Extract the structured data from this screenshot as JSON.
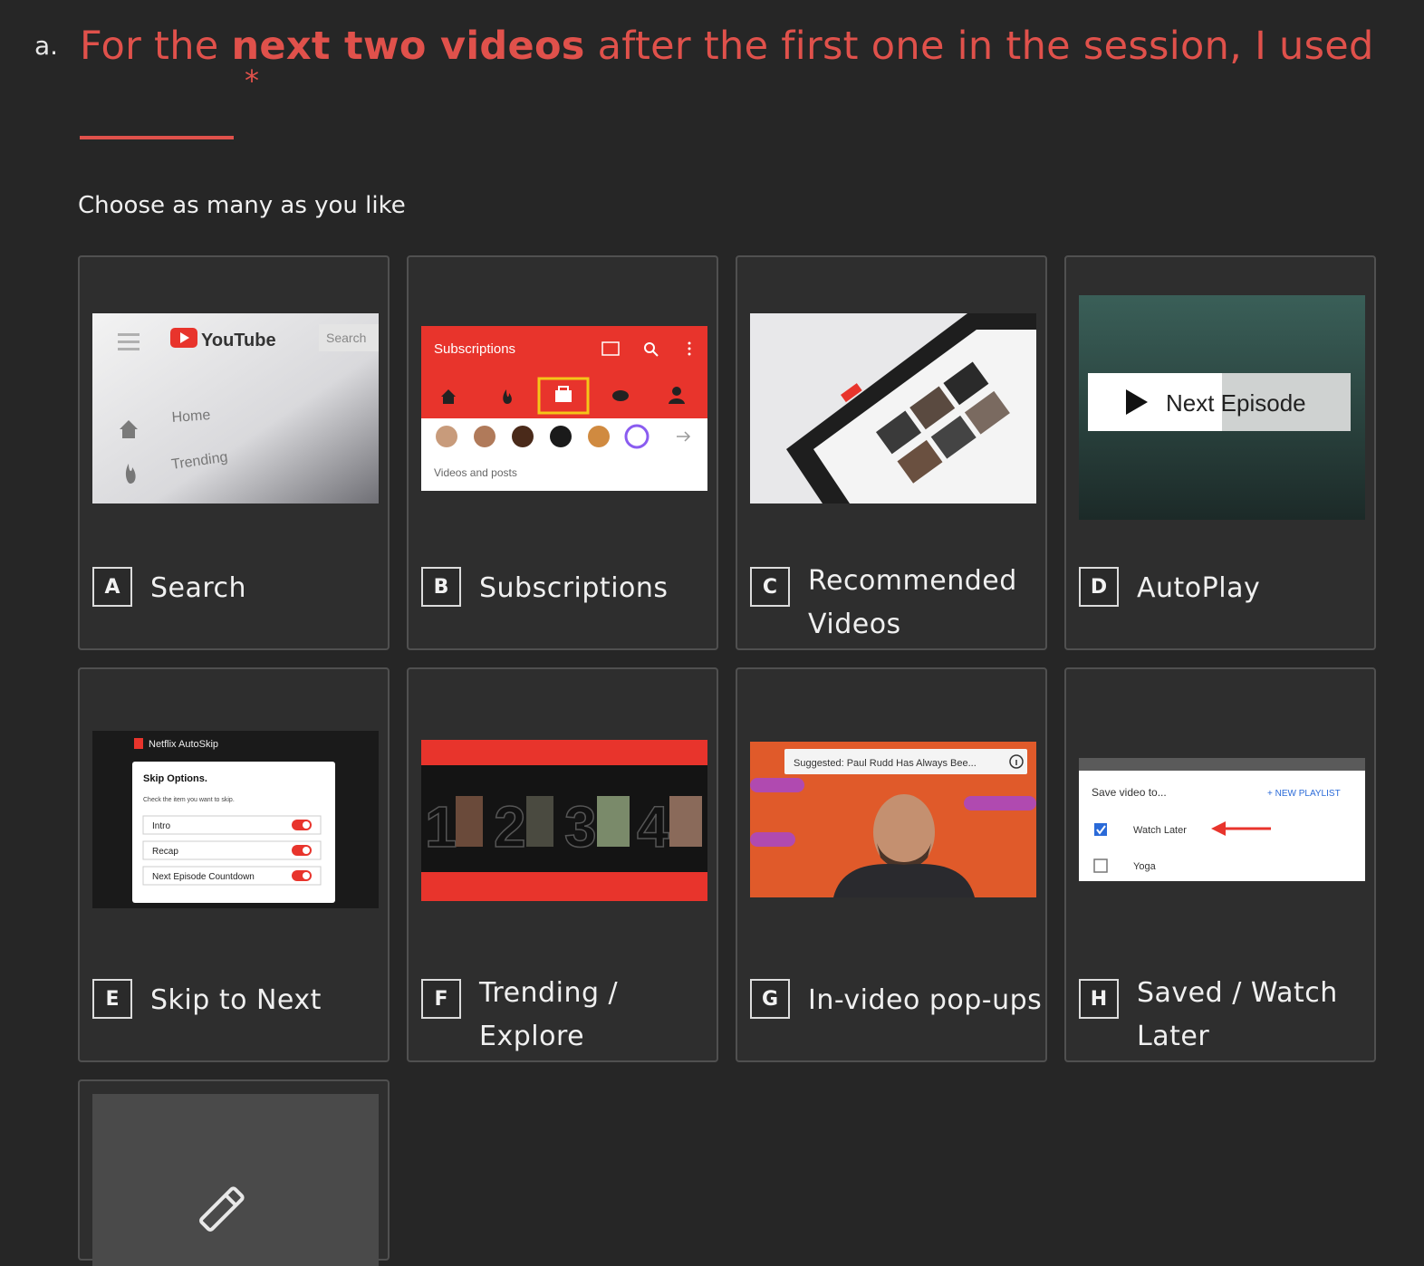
{
  "question": {
    "number": "a.",
    "text_before": "For the ",
    "text_bold": "next two videos",
    "text_after": " after the first one in the session, I used",
    "required_mark": "*"
  },
  "hint": "Choose as many as you like",
  "options": [
    {
      "key": "A",
      "label": "Search"
    },
    {
      "key": "B",
      "label": "Subscriptions"
    },
    {
      "key": "C",
      "label": "Recommended Videos"
    },
    {
      "key": "D",
      "label": "AutoPlay"
    },
    {
      "key": "E",
      "label": "Skip to Next"
    },
    {
      "key": "F",
      "label": "Trending / Explore"
    },
    {
      "key": "G",
      "label": "In-video pop-ups"
    },
    {
      "key": "H",
      "label": "Saved / Watch Later"
    }
  ],
  "thumb_text": {
    "a_brand": "YouTube",
    "a_search": "Search",
    "a_home": "Home",
    "a_trending": "Trending",
    "b_title": "Subscriptions",
    "b_filter": "Videos and posts",
    "d_button": "Next Episode",
    "e_app": "Netflix AutoSkip",
    "e_title": "Skip Options.",
    "e_sub": "Check the item you want to skip.",
    "e_item1": "Intro",
    "e_item2": "Recap",
    "e_item3": "Next Episode Countdown",
    "f_numbers": [
      "1",
      "2",
      "3",
      "4"
    ],
    "g_popup": "Suggested: Paul Rudd Has Always Bee...",
    "h_title": "Save video to...",
    "h_new": "+ NEW PLAYLIST",
    "h_item1": "Watch Later",
    "h_item2": "Yoga"
  },
  "colors": {
    "accent_red": "#e0514b",
    "youtube_red": "#e8342c",
    "background": "#262626",
    "card": "#2e2e2e"
  }
}
